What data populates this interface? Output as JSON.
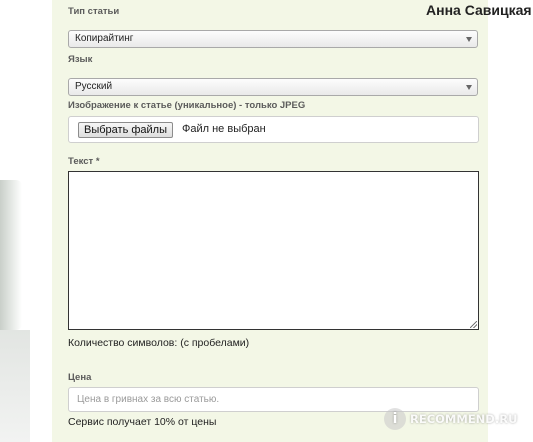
{
  "header": {
    "user_name": "Анна Савицкая"
  },
  "form": {
    "article_type": {
      "label": "Тип статьи",
      "value": "Копирайтинг"
    },
    "language": {
      "label": "Язык",
      "value": "Русский"
    },
    "image": {
      "label": "Изображение к статье (уникальное) - только JPEG",
      "button_label": "Выбрать файлы",
      "status": "Файл не выбран"
    },
    "text": {
      "label": "Текст *",
      "value": ""
    },
    "char_count": "Количество символов: (с пробелами)",
    "price": {
      "label": "Цена",
      "placeholder": "Цена в гривнах за всю статью.",
      "note": "Сервис получает 10% от цены"
    }
  },
  "watermark": {
    "text": "RECOMMEND.RU",
    "logo_letter": "i"
  }
}
